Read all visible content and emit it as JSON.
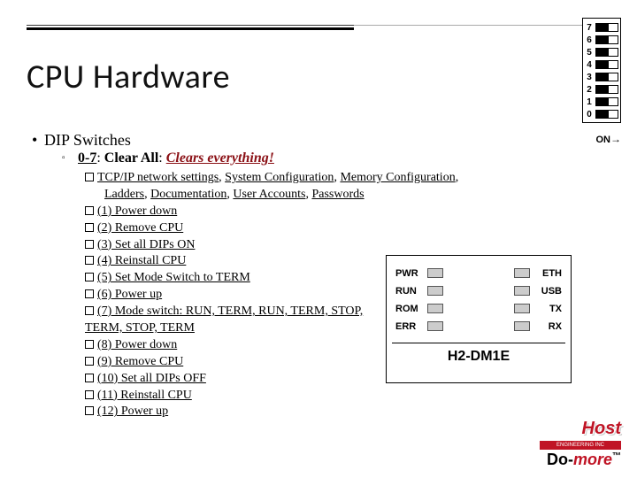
{
  "title": "CPU Hardware",
  "main_bullet": "DIP Switches",
  "sub": {
    "range": "0-7",
    "label": "Clear All",
    "emph": "Clears everything!"
  },
  "desc_parts": {
    "a": "TCP/IP network settings",
    "b": "System Configuration",
    "c": "Memory Configuration",
    "d": "Ladders",
    "e": "Documentation",
    "f": "User Accounts",
    "g": "Passwords"
  },
  "steps": [
    "(1) Power down",
    "(2) Remove CPU",
    "(3) Set all DIPs ON",
    "(4) Reinstall CPU",
    "(5) Set Mode Switch to TERM",
    "(6) Power up",
    "(7) Mode switch: RUN, TERM, RUN, TERM, STOP, TERM, STOP, TERM",
    "(8) Power down",
    "(9) Remove CPU",
    "(10) Set all DIPs OFF",
    "(11) Reinstall CPU",
    "(12) Power up"
  ],
  "dip": {
    "numbers": [
      "7",
      "6",
      "5",
      "4",
      "3",
      "2",
      "1",
      "0"
    ],
    "on_label": "ON"
  },
  "module": {
    "left": [
      "PWR",
      "RUN",
      "ROM",
      "ERR"
    ],
    "right": [
      "ETH",
      "USB",
      "TX",
      "RX"
    ],
    "model": "H2-DM1E"
  },
  "logo": {
    "brand": "Host",
    "tag": "ENGINEERING INC",
    "domore_a": "Do-",
    "domore_b": "more",
    "tm": "™"
  }
}
